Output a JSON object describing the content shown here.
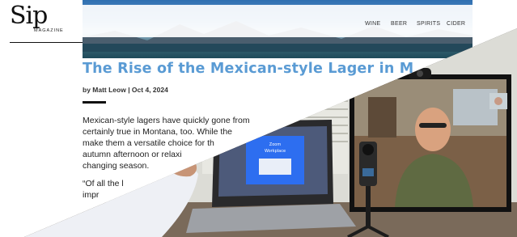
{
  "site": {
    "logo_word": "Sip",
    "logo_sub": "MAGAZINE",
    "nav": [
      "WINE",
      "BEER",
      "SPIRITS",
      "CIDER"
    ],
    "article": {
      "title": "The Rise of the Mexican-style Lager in M",
      "byline": "by Matt Leow | Oct 4, 2024",
      "paragraph_lines": [
        "Mexican-style lagers have quickly gone from",
        "certainly true in Montana, too. While the",
        "make them a versatile choice for th",
        "autumn afternoon or relaxi",
        "changing season."
      ],
      "quote_lines": [
        "“Of all the l",
        "impr"
      ]
    }
  },
  "laptop_screen": {
    "app_title": "Zoom\nWorkplace"
  },
  "colors": {
    "title_blue": "#5a9bd4",
    "zoom_blue": "#2d6ef0",
    "text_dark": "#222222"
  },
  "icons": [
    "webcam-icon",
    "gimbal-camera-icon"
  ]
}
